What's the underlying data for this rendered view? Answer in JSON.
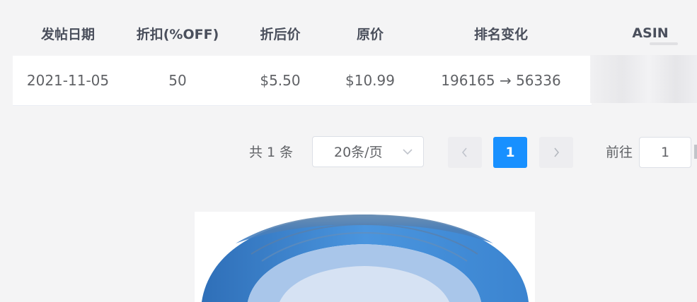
{
  "table": {
    "headers": [
      "发帖日期",
      "折扣(%OFF)",
      "折后价",
      "原价",
      "排名变化",
      "ASIN"
    ],
    "rows": [
      [
        "2021-11-05",
        "50",
        "$5.50",
        "$10.99",
        "196165 → 56336"
      ]
    ]
  },
  "pagination": {
    "total_text": "共 1 条",
    "page_size": "20条/页",
    "current_page": "1",
    "goto_label": "前往",
    "goto_value": "1"
  },
  "colors": {
    "accent": "#1890ff",
    "background": "#f4f4f5",
    "header_text": "#4a4f5c",
    "body_text": "#606266",
    "tape_blue": "#3d8fd9"
  },
  "icons": {
    "prev": "chevron-left-icon",
    "next": "chevron-right-icon",
    "select_arrow": "chevron-down-icon"
  }
}
